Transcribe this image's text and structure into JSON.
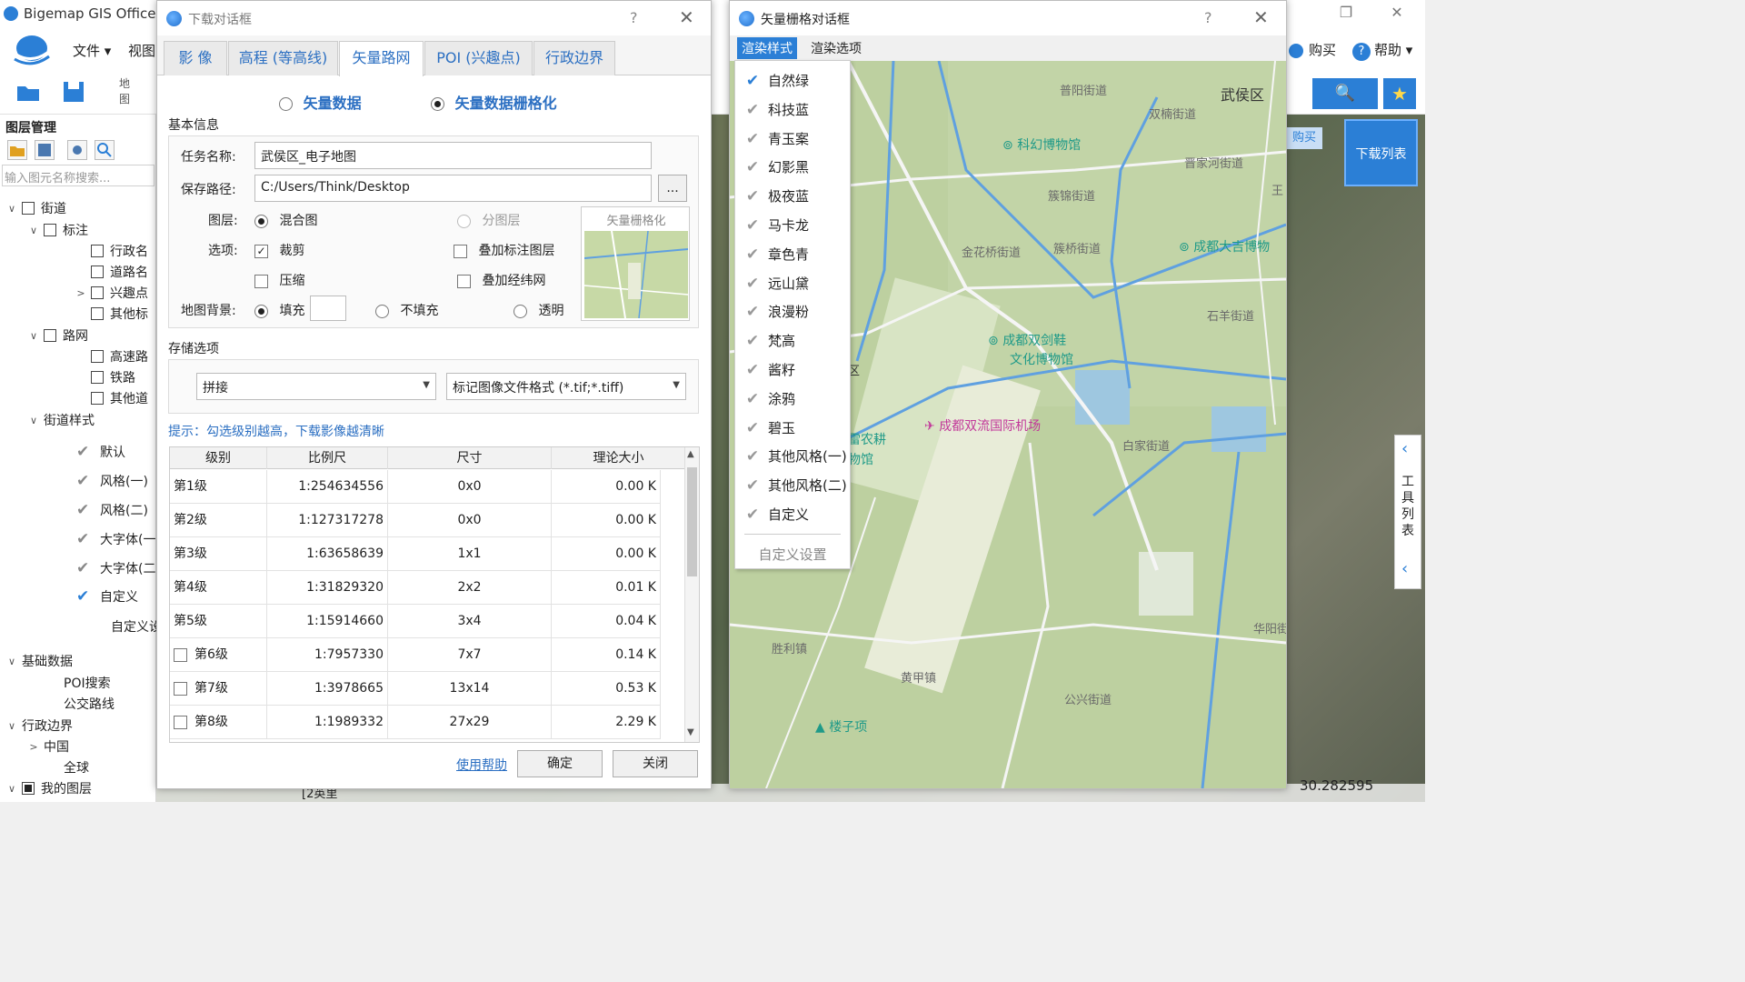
{
  "app": {
    "title": "Bigemap GIS Office",
    "menu": [
      "文件 ▾",
      "视图"
    ],
    "quickbar_label": "地\n图",
    "buy": "购买",
    "help": "帮助 ▾",
    "download_list": "下载列表",
    "buy_badge": "购买",
    "tool_list": "工具列表",
    "status_left": "[2英里",
    "status_coord": "30.282595"
  },
  "left_panel": {
    "title": "图层管理",
    "search_placeholder": "输入图元名称搜索...",
    "tree": [
      {
        "label": "街道",
        "arrow": "∨",
        "check": "box",
        "indent": 0
      },
      {
        "label": "标注",
        "arrow": "∨",
        "check": "box",
        "indent": 1
      },
      {
        "label": "行政名",
        "arrow": "",
        "check": "box",
        "indent": 2
      },
      {
        "label": "道路名",
        "arrow": "",
        "check": "box",
        "indent": 2
      },
      {
        "label": "兴趣点",
        "arrow": ">",
        "check": "box",
        "indent": 2
      },
      {
        "label": "其他标",
        "arrow": "",
        "check": "box",
        "indent": 2
      },
      {
        "label": "路网",
        "arrow": "∨",
        "check": "box",
        "indent": 1
      },
      {
        "label": "高速路",
        "arrow": "",
        "check": "box",
        "indent": 2
      },
      {
        "label": "铁路",
        "arrow": "",
        "check": "box",
        "indent": 2
      },
      {
        "label": "其他道",
        "arrow": "",
        "check": "box",
        "indent": 2
      },
      {
        "label": "街道样式",
        "arrow": "∨",
        "check": "none",
        "indent": 1
      },
      {
        "label": "默认",
        "arrow": "",
        "check": "tick",
        "indent": 2
      },
      {
        "label": "风格(一)",
        "arrow": "",
        "check": "tick",
        "indent": 2
      },
      {
        "label": "风格(二)",
        "arrow": "",
        "check": "tick",
        "indent": 2
      },
      {
        "label": "大字体(一",
        "arrow": "",
        "check": "tick",
        "indent": 2
      },
      {
        "label": "大字体(二",
        "arrow": "",
        "check": "tick",
        "indent": 2
      },
      {
        "label": "自定义",
        "arrow": "",
        "check": "tick-blue",
        "indent": 2
      },
      {
        "label": "自定义设置",
        "arrow": "",
        "check": "none",
        "indent": 3
      },
      {
        "label": "基础数据",
        "arrow": "∨",
        "check": "none",
        "indent": 0
      },
      {
        "label": "POI搜索",
        "arrow": "",
        "check": "none",
        "indent": 2
      },
      {
        "label": "公交路线",
        "arrow": "",
        "check": "none",
        "indent": 2
      },
      {
        "label": "行政边界",
        "arrow": "∨",
        "check": "none",
        "indent": 0
      },
      {
        "label": "中国",
        "arrow": ">",
        "check": "none",
        "indent": 1
      },
      {
        "label": "全球",
        "arrow": "",
        "check": "none",
        "indent": 2
      },
      {
        "label": "我的图层",
        "arrow": "∨",
        "check": "filled",
        "indent": 0
      }
    ]
  },
  "download_dialog": {
    "title": "下载对话框",
    "help": "?",
    "close": "✕",
    "tabs": [
      "影 像",
      "高程 (等高线)",
      "矢量路网",
      "POI (兴趣点)",
      "行政边界"
    ],
    "active_tab": 2,
    "mode_options": [
      "矢量数据",
      "矢量数据栅格化"
    ],
    "mode_selected": 1,
    "basic_info_label": "基本信息",
    "task_name_label": "任务名称:",
    "task_name_value": "武侯区_电子地图",
    "save_path_label": "保存路径:",
    "save_path_value": "C:/Users/Think/Desktop",
    "browse_label": "...",
    "layer_label": "图层:",
    "layer_options": [
      "混合图",
      "分图层"
    ],
    "options_label": "选项:",
    "opt_clip": "裁剪",
    "opt_overlay_label": "叠加标注图层",
    "opt_compress": "压缩",
    "opt_graticule": "叠加经纬网",
    "bg_label": "地图背景:",
    "bg_options": [
      "填充",
      "不填充",
      "透明"
    ],
    "preview_title": "矢量栅格化",
    "storage_label": "存储选项",
    "storage_mode": "拼接",
    "file_format": "标记图像文件格式 (*.tif;*.tiff)",
    "hint": "提示：勾选级别越高，下载影像越清晰",
    "table_headers": [
      "级别",
      "比例尺",
      "尺寸",
      "理论大小"
    ],
    "table_rows": [
      {
        "level": "第1级",
        "scale": "1:254634556",
        "size": "0x0",
        "est": "0.00 K",
        "checkbox": false
      },
      {
        "level": "第2级",
        "scale": "1:127317278",
        "size": "0x0",
        "est": "0.00 K",
        "checkbox": false
      },
      {
        "level": "第3级",
        "scale": "1:63658639",
        "size": "1x1",
        "est": "0.00 K",
        "checkbox": false
      },
      {
        "level": "第4级",
        "scale": "1:31829320",
        "size": "2x2",
        "est": "0.01 K",
        "checkbox": false
      },
      {
        "level": "第5级",
        "scale": "1:15914660",
        "size": "3x4",
        "est": "0.04 K",
        "checkbox": false
      },
      {
        "level": "第6级",
        "scale": "1:7957330",
        "size": "7x7",
        "est": "0.14 K",
        "checkbox": true
      },
      {
        "level": "第7级",
        "scale": "1:3978665",
        "size": "13x14",
        "est": "0.53 K",
        "checkbox": true
      },
      {
        "level": "第8级",
        "scale": "1:1989332",
        "size": "27x29",
        "est": "2.29 K",
        "checkbox": true
      }
    ],
    "help_link": "使用帮助",
    "ok": "确定",
    "close_btn": "关闭"
  },
  "vector_dialog": {
    "title": "矢量栅格对话框",
    "help": "?",
    "close": "✕",
    "tabs": [
      "渲染样式",
      "渲染选项"
    ],
    "styles": [
      "自然绿",
      "科技蓝",
      "青玉案",
      "幻影黑",
      "极夜蓝",
      "马卡龙",
      "章色青",
      "远山黛",
      "浪漫粉",
      "梵高",
      "酱籽",
      "涂鸦",
      "碧玉",
      "其他风格(一)",
      "其他风格(二)",
      "自定义"
    ],
    "selected_style": 0,
    "custom_settings": "自定义设置",
    "map_labels": [
      {
        "text": "武侯区",
        "cls": "district"
      },
      {
        "text": "普阳街道"
      },
      {
        "text": "双楠街道"
      },
      {
        "text": "簇锦街道"
      },
      {
        "text": "金花桥街道"
      },
      {
        "text": "簇桥街道"
      },
      {
        "text": "石羊街道"
      },
      {
        "text": "白家街道"
      },
      {
        "text": "胜利镇"
      },
      {
        "text": "黄甲镇"
      },
      {
        "text": "公兴街道"
      },
      {
        "text": "华阳街"
      },
      {
        "text": "晋家河街道"
      },
      {
        "text": "王"
      }
    ],
    "map_pois": [
      {
        "text": "科幻博物馆"
      },
      {
        "text": "成都大吉博物"
      },
      {
        "text": "成都双剑鞋"
      },
      {
        "text": "文化博物馆"
      },
      {
        "text": "楼子项"
      }
    ],
    "airport": "成都双流国际机场",
    "partial_labels": [
      "区",
      "雷农耕",
      "物馆"
    ]
  }
}
